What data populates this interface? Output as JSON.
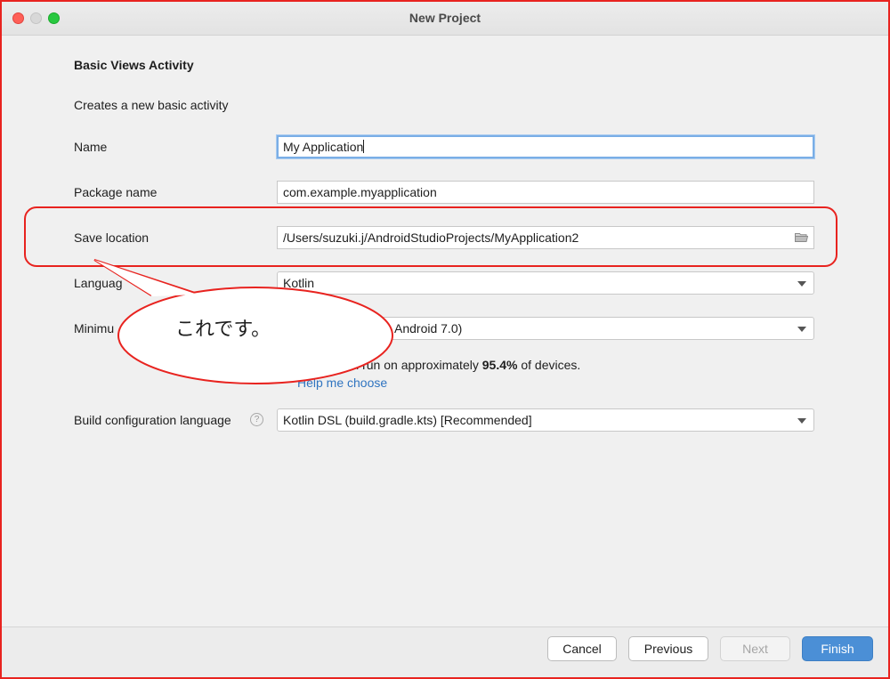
{
  "window": {
    "title": "New Project"
  },
  "form": {
    "heading": "Basic Views Activity",
    "description": "Creates a new basic activity",
    "name": {
      "label": "Name",
      "value": "My Application"
    },
    "package": {
      "label": "Package name",
      "value": "com.example.myapplication"
    },
    "save_location": {
      "label": "Save location",
      "value": "/Users/suzuki.j/AndroidStudioProjects/MyApplication2"
    },
    "language": {
      "label": "Language",
      "visible_label": "Languag",
      "value": "Kotlin"
    },
    "minimum_sdk": {
      "visible_label": "Minimu",
      "visible_value": "Android 7.0)"
    },
    "sdk_info": {
      "prefix": "ll run on approximately ",
      "percent": "95.4%",
      "suffix": " of devices."
    },
    "help_link": "Help me choose",
    "build_config": {
      "label": "Build configuration language",
      "help": "?",
      "value": "Kotlin DSL (build.gradle.kts) [Recommended]"
    }
  },
  "buttons": {
    "cancel": "Cancel",
    "previous": "Previous",
    "next": "Next",
    "finish": "Finish"
  },
  "annotation": {
    "text": "これです。",
    "color": "#e8231f"
  }
}
